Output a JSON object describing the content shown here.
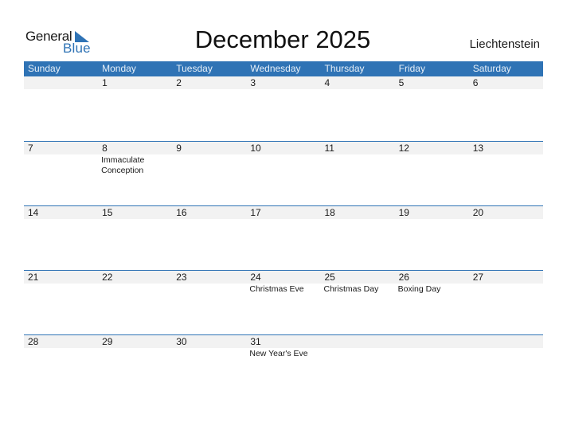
{
  "brand": {
    "part1": "General",
    "part2": "Blue",
    "accent": "#2f73b5"
  },
  "title": "December 2025",
  "country": "Liechtenstein",
  "weekdays": [
    "Sunday",
    "Monday",
    "Tuesday",
    "Wednesday",
    "Thursday",
    "Friday",
    "Saturday"
  ],
  "weeks": [
    {
      "days": [
        "",
        "1",
        "2",
        "3",
        "4",
        "5",
        "6"
      ],
      "events": [
        "",
        "",
        "",
        "",
        "",
        "",
        ""
      ]
    },
    {
      "days": [
        "7",
        "8",
        "9",
        "10",
        "11",
        "12",
        "13"
      ],
      "events": [
        "",
        "Immaculate Conception",
        "",
        "",
        "",
        "",
        ""
      ]
    },
    {
      "days": [
        "14",
        "15",
        "16",
        "17",
        "18",
        "19",
        "20"
      ],
      "events": [
        "",
        "",
        "",
        "",
        "",
        "",
        ""
      ]
    },
    {
      "days": [
        "21",
        "22",
        "23",
        "24",
        "25",
        "26",
        "27"
      ],
      "events": [
        "",
        "",
        "",
        "Christmas Eve",
        "Christmas Day",
        "Boxing Day",
        ""
      ]
    },
    {
      "days": [
        "28",
        "29",
        "30",
        "31",
        "",
        "",
        ""
      ],
      "events": [
        "",
        "",
        "",
        "New Year's Eve",
        "",
        "",
        ""
      ]
    }
  ]
}
